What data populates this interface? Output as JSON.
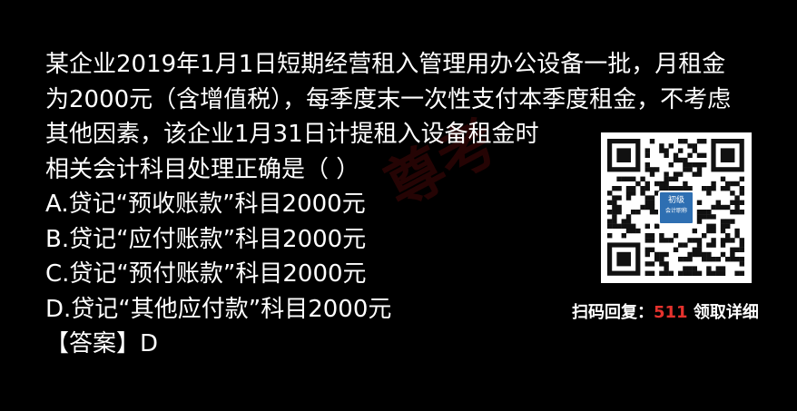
{
  "question": {
    "lines": [
      "某企业2019年1月1日短期经营租入管理用办公设备一批，月租金",
      "为2000元（含增值税），每季度末一次性支付本季度租金，不考虑",
      "其他因素，该企业1月31日计提租入设备租金时",
      "相关会计科目处理正确是（ ）"
    ],
    "options": [
      "A.贷记“预收账款”科目2000元",
      "B.贷记“应付账款”科目2000元",
      "C.贷记“预付账款”科目2000元",
      "D.贷记“其他应付款”科目2000元"
    ],
    "answer": "【答案】D"
  },
  "qr": {
    "badge_line1": "初级",
    "badge_line2": "会计职称"
  },
  "caption": {
    "prefix": "扫码回复：",
    "code": "511",
    "suffix": " 领取详细"
  },
  "watermark": {
    "text": "尊考"
  },
  "colors": {
    "background": "#000000",
    "text": "#ffffff",
    "accent": "#e5322d",
    "badge": "#2e6fb2"
  }
}
